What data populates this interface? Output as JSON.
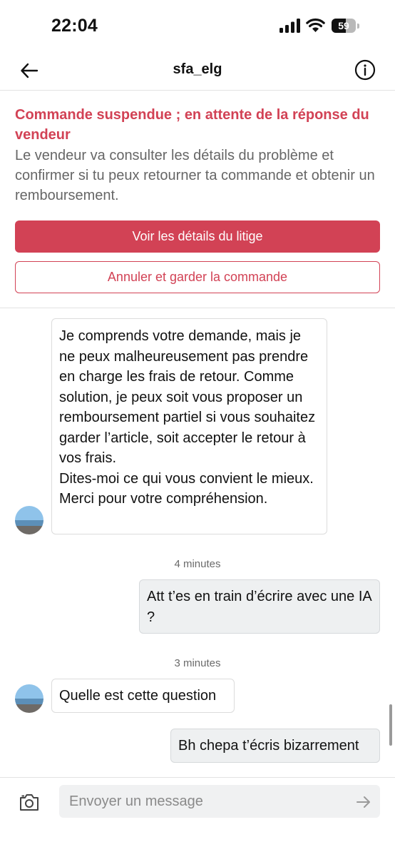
{
  "status_bar": {
    "time": "22:04",
    "battery": "59",
    "battery_level_percent": 59,
    "icons": [
      "cellular-signal-icon",
      "wifi-icon",
      "battery-icon"
    ]
  },
  "header": {
    "title": "sfa_elg",
    "icons": [
      "back-arrow-icon",
      "info-icon"
    ]
  },
  "dispute": {
    "title": "Commande suspendue ; en attente de la réponse du vendeur",
    "description": "Le vendeur va consulter les détails du problème et confirmer si tu peux retourner ta commande et obtenir un remboursement.",
    "primary_button": "Voir les détails du litige",
    "secondary_button": "Annuler et garder la commande",
    "accent_color": "#d24255"
  },
  "chat": {
    "messages": [
      {
        "sender": "seller",
        "text": "Je comprends votre demande, mais je ne peux malheureusement pas prendre en charge les frais de retour. Comme solution, je peux soit vous proposer un remboursement partiel si vous souhaitez garder l’article, soit accepter le retour à vos frais.\nDites-moi ce qui vous convient le mieux.\nMerci pour votre compréhension."
      },
      {
        "timestamp": "4 minutes"
      },
      {
        "sender": "me",
        "text": "Att t’es en train d’écrire avec une IA ?"
      },
      {
        "timestamp": "3 minutes"
      },
      {
        "sender": "seller",
        "text": "Quelle est cette question"
      },
      {
        "sender": "me",
        "text": "Bh chepa t’écris bizarrement"
      }
    ],
    "ts1": "4 minutes",
    "ts2": "3 minutes"
  },
  "composer": {
    "placeholder": "Envoyer un message",
    "icons": [
      "camera-icon",
      "send-arrow-icon"
    ]
  }
}
